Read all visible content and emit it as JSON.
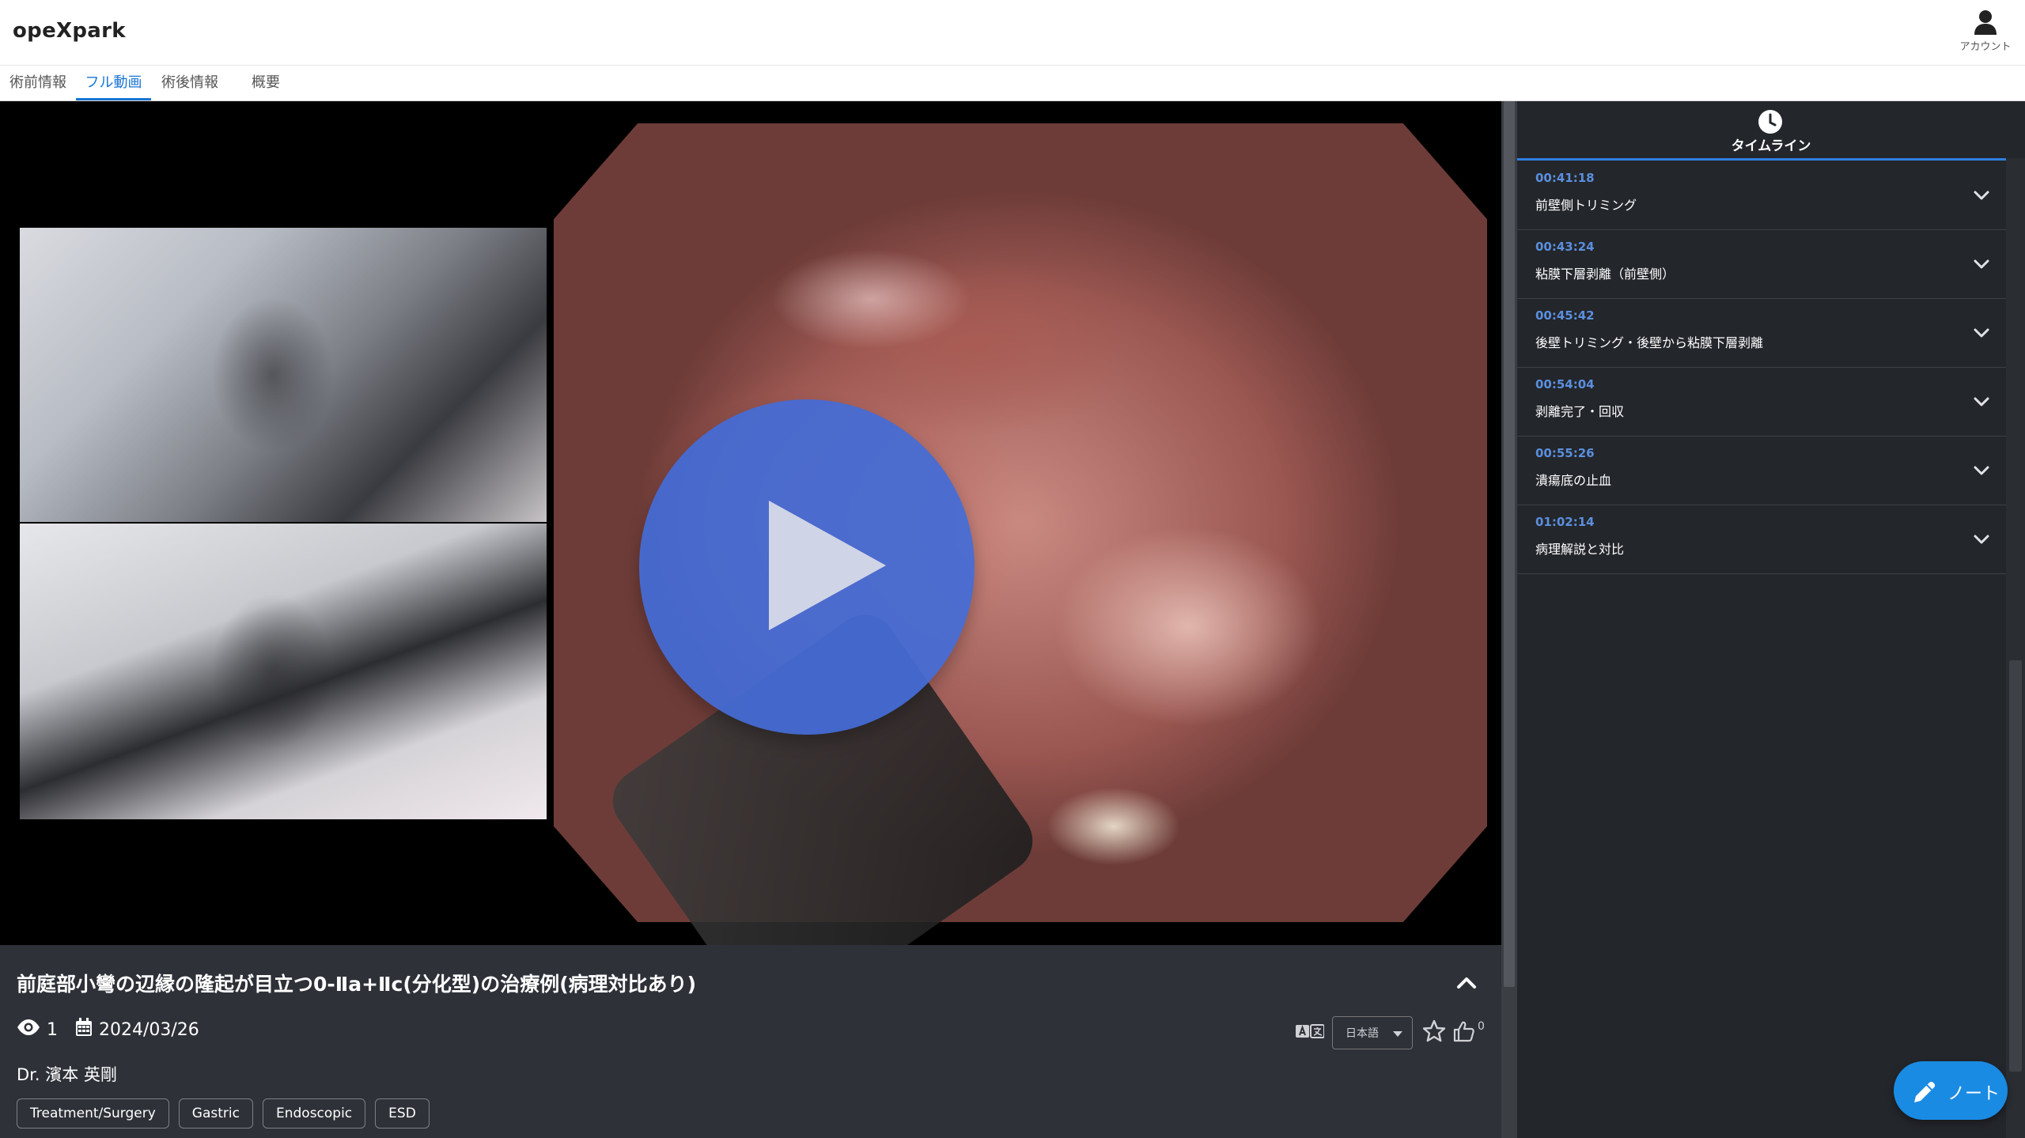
{
  "header": {
    "logo": "opeXpark",
    "account_label": "アカウント",
    "account_icon": "user-icon"
  },
  "tabs": [
    {
      "label": "術前情報",
      "active": false
    },
    {
      "label": "フル動画",
      "active": true
    },
    {
      "label": "術後情報",
      "active": false
    },
    {
      "label": "概要",
      "active": false
    }
  ],
  "video": {
    "play_icon": "play-icon",
    "state": "paused"
  },
  "info": {
    "title": "前庭部小彎の辺縁の隆起が目立つ0-Ⅱa+Ⅱc(分化型)の治療例(病理対比あり)",
    "views": "1",
    "date": "2024/03/26",
    "doctor": "Dr. 濱本 英剛",
    "language": "日本語",
    "likes": "0",
    "tags": [
      "Treatment/Surgery",
      "Gastric",
      "Endoscopic",
      "ESD"
    ]
  },
  "sidebar": {
    "title": "タイムライン",
    "items": [
      {
        "time": "00:41:18",
        "label": "前壁側トリミング"
      },
      {
        "time": "00:43:24",
        "label": "粘膜下層剥離（前壁側）"
      },
      {
        "time": "00:45:42",
        "label": "後壁トリミング・後壁から粘膜下層剥離"
      },
      {
        "time": "00:54:04",
        "label": "剥離完了・回収"
      },
      {
        "time": "00:55:26",
        "label": "潰瘍底の止血"
      },
      {
        "time": "01:02:14",
        "label": "病理解説と対比"
      }
    ]
  },
  "note_button": {
    "label": "ノート"
  },
  "colors": {
    "accent": "#1976d2",
    "play": "#446cd6",
    "timeline_time": "#5b8fdd",
    "panel_bg": "#2e3138",
    "sidebar_bg": "#23262b"
  }
}
